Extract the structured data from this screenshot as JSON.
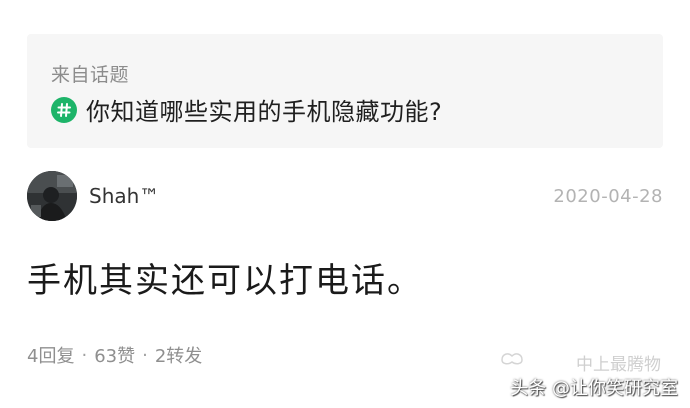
{
  "topic": {
    "header": "来自话题",
    "icon": "hashtag-icon",
    "title": "你知道哪些实用的手机隐藏功能?"
  },
  "post": {
    "author": "Shah™",
    "date": "2020-04-28",
    "body": "手机其实还可以打电话。"
  },
  "stats": {
    "replies": "4回复",
    "likes": "63赞",
    "reposts": "2转发",
    "separator": "·"
  },
  "watermark": {
    "line1": "中上最腾物",
    "line2": "头条 @让你笑研究室"
  },
  "colors": {
    "accent_green": "#1db469",
    "card_bg": "#f6f6f6",
    "muted_text": "#8c8c8c"
  }
}
